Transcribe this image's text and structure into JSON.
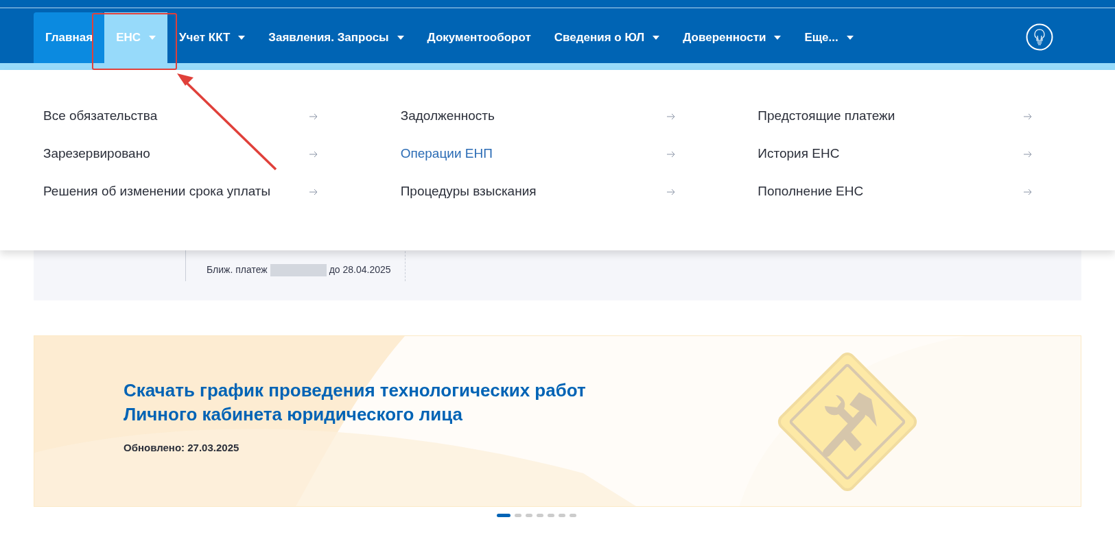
{
  "nav": {
    "items": [
      {
        "label": "Главная",
        "caret": false,
        "selected": true,
        "open": false
      },
      {
        "label": "ЕНС",
        "caret": true,
        "selected": false,
        "open": true
      },
      {
        "label": "Учет ККТ",
        "caret": true,
        "selected": false,
        "open": false
      },
      {
        "label": "Заявления. Запросы",
        "caret": true,
        "selected": false,
        "open": false
      },
      {
        "label": "Документооборот",
        "caret": false,
        "selected": false,
        "open": false
      },
      {
        "label": "Сведения о ЮЛ",
        "caret": true,
        "selected": false,
        "open": false
      },
      {
        "label": "Доверенности",
        "caret": true,
        "selected": false,
        "open": false
      },
      {
        "label": "Еще...",
        "caret": true,
        "selected": false,
        "open": false
      }
    ]
  },
  "dropdown": {
    "columns": [
      [
        {
          "label": "Все обязательства",
          "selected": false
        },
        {
          "label": "Зарезервировано",
          "selected": false
        },
        {
          "label": "Решения об изменении срока уплаты",
          "selected": false
        }
      ],
      [
        {
          "label": "Задолженность",
          "selected": false
        },
        {
          "label": "Операции ЕНП",
          "selected": true
        },
        {
          "label": "Процедуры взыскания",
          "selected": false
        }
      ],
      [
        {
          "label": "Предстоящие платежи",
          "selected": false
        },
        {
          "label": "История ЕНС",
          "selected": false
        },
        {
          "label": "Пополнение ЕНС",
          "selected": false
        }
      ]
    ]
  },
  "summary": {
    "next_payment_label": "Ближ. платеж",
    "next_payment_due": "до 28.04.2025"
  },
  "banner": {
    "title": "Скачать график проведения технологических работ Личного кабинета юридического лица",
    "updated": "Обновлено: 27.03.2025"
  },
  "carousel": {
    "dots": [
      {
        "selected": true
      },
      {
        "selected": false
      },
      {
        "selected": false
      },
      {
        "selected": false
      },
      {
        "selected": false
      },
      {
        "selected": false
      },
      {
        "selected": false
      }
    ]
  }
}
